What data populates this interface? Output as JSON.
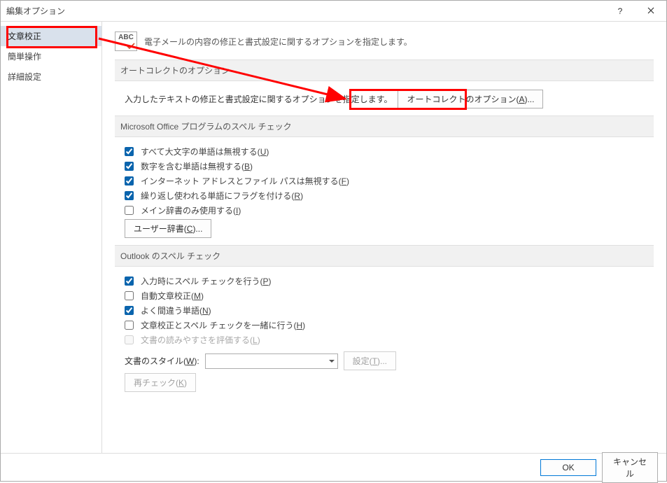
{
  "window": {
    "title": "編集オプション",
    "help_tip": "?",
    "close_tip": "×"
  },
  "sidebar": {
    "items": [
      {
        "label": "文章校正"
      },
      {
        "label": "簡単操作"
      },
      {
        "label": "詳細設定"
      }
    ],
    "selected": 0
  },
  "intro": {
    "icon_label": "ABC",
    "text": "電子メールの内容の修正と書式設定に関するオプションを指定します。"
  },
  "sections": {
    "autocorrect": {
      "header": "オートコレクトのオプション",
      "desc": "入力したテキストの修正と書式設定に関するオプションを指定します。",
      "button": "オートコレクトのオプション(A)...",
      "button_mn": "A"
    },
    "office_spell": {
      "header": "Microsoft Office プログラムのスペル チェック",
      "items": [
        {
          "label_pre": "すべて大文字の単語は無視する(",
          "mn": "U",
          "label_post": ")",
          "checked": true
        },
        {
          "label_pre": "数字を含む単語は無視する(",
          "mn": "B",
          "label_post": ")",
          "checked": true
        },
        {
          "label_pre": "インターネット アドレスとファイル パスは無視する(",
          "mn": "F",
          "label_post": ")",
          "checked": true
        },
        {
          "label_pre": "繰り返し使われる単語にフラグを付ける(",
          "mn": "R",
          "label_post": ")",
          "checked": true
        },
        {
          "label_pre": "メイン辞書のみ使用する(",
          "mn": "I",
          "label_post": ")",
          "checked": false
        }
      ],
      "custom_dict_btn": "ユーザー辞書(C)...",
      "custom_dict_mn": "C"
    },
    "outlook_spell": {
      "header": "Outlook のスペル チェック",
      "items": [
        {
          "label_pre": "入力時にスペル チェックを行う(",
          "mn": "P",
          "label_post": ")",
          "checked": true,
          "disabled": false
        },
        {
          "label_pre": "自動文章校正(",
          "mn": "M",
          "label_post": ")",
          "checked": false,
          "disabled": false
        },
        {
          "label_pre": "よく間違う単語(",
          "mn": "N",
          "label_post": ")",
          "checked": true,
          "disabled": false
        },
        {
          "label_pre": "文章校正とスペル チェックを一緒に行う(",
          "mn": "H",
          "label_post": ")",
          "checked": false,
          "disabled": false
        },
        {
          "label_pre": "文書の読みやすさを評価する(",
          "mn": "L",
          "label_post": ")",
          "checked": false,
          "disabled": true
        }
      ],
      "style_label_pre": "文書のスタイル(",
      "style_mn": "W",
      "style_label_post": "):",
      "style_value": "",
      "settings_btn": "設定(T)...",
      "settings_mn": "T",
      "recheck_btn": "再チェック(K)",
      "recheck_mn": "K"
    }
  },
  "footer": {
    "ok": "OK",
    "cancel": "キャンセル"
  },
  "annotation_color": "#ff0000"
}
